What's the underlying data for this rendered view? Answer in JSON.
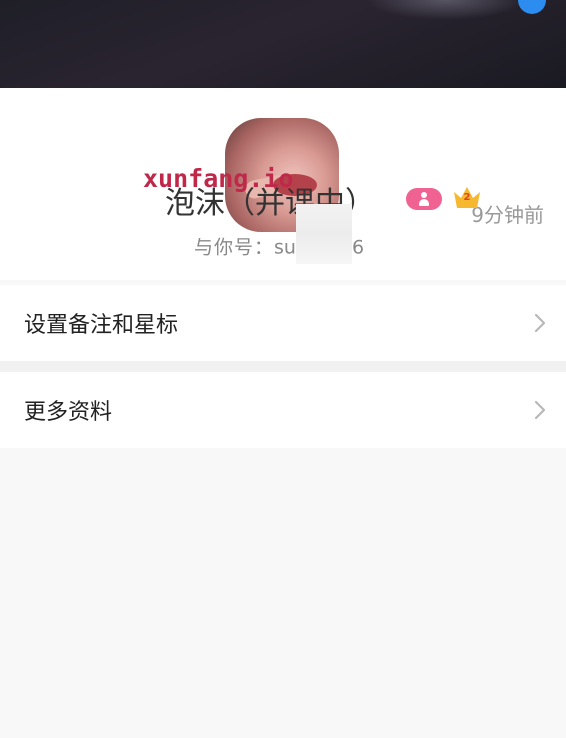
{
  "profile": {
    "time_ago": "9分钟前",
    "nickname": "泡沫（并课中）",
    "crown_level": "2",
    "account_prefix": "与你号：",
    "account_start": "su",
    "account_end": "6"
  },
  "watermark": "xunfang.io",
  "menu": [
    {
      "label": "设置备注和星标"
    },
    {
      "label": "更多资料"
    }
  ],
  "colors": {
    "accent_blue": "#2d8cf0",
    "gender_badge": "#f06292",
    "crown": "#f5b82e",
    "watermark": "#c0284a"
  },
  "icons": [
    "avatar",
    "gender-badge-icon",
    "crown-level-icon",
    "chevron-right-icon"
  ]
}
